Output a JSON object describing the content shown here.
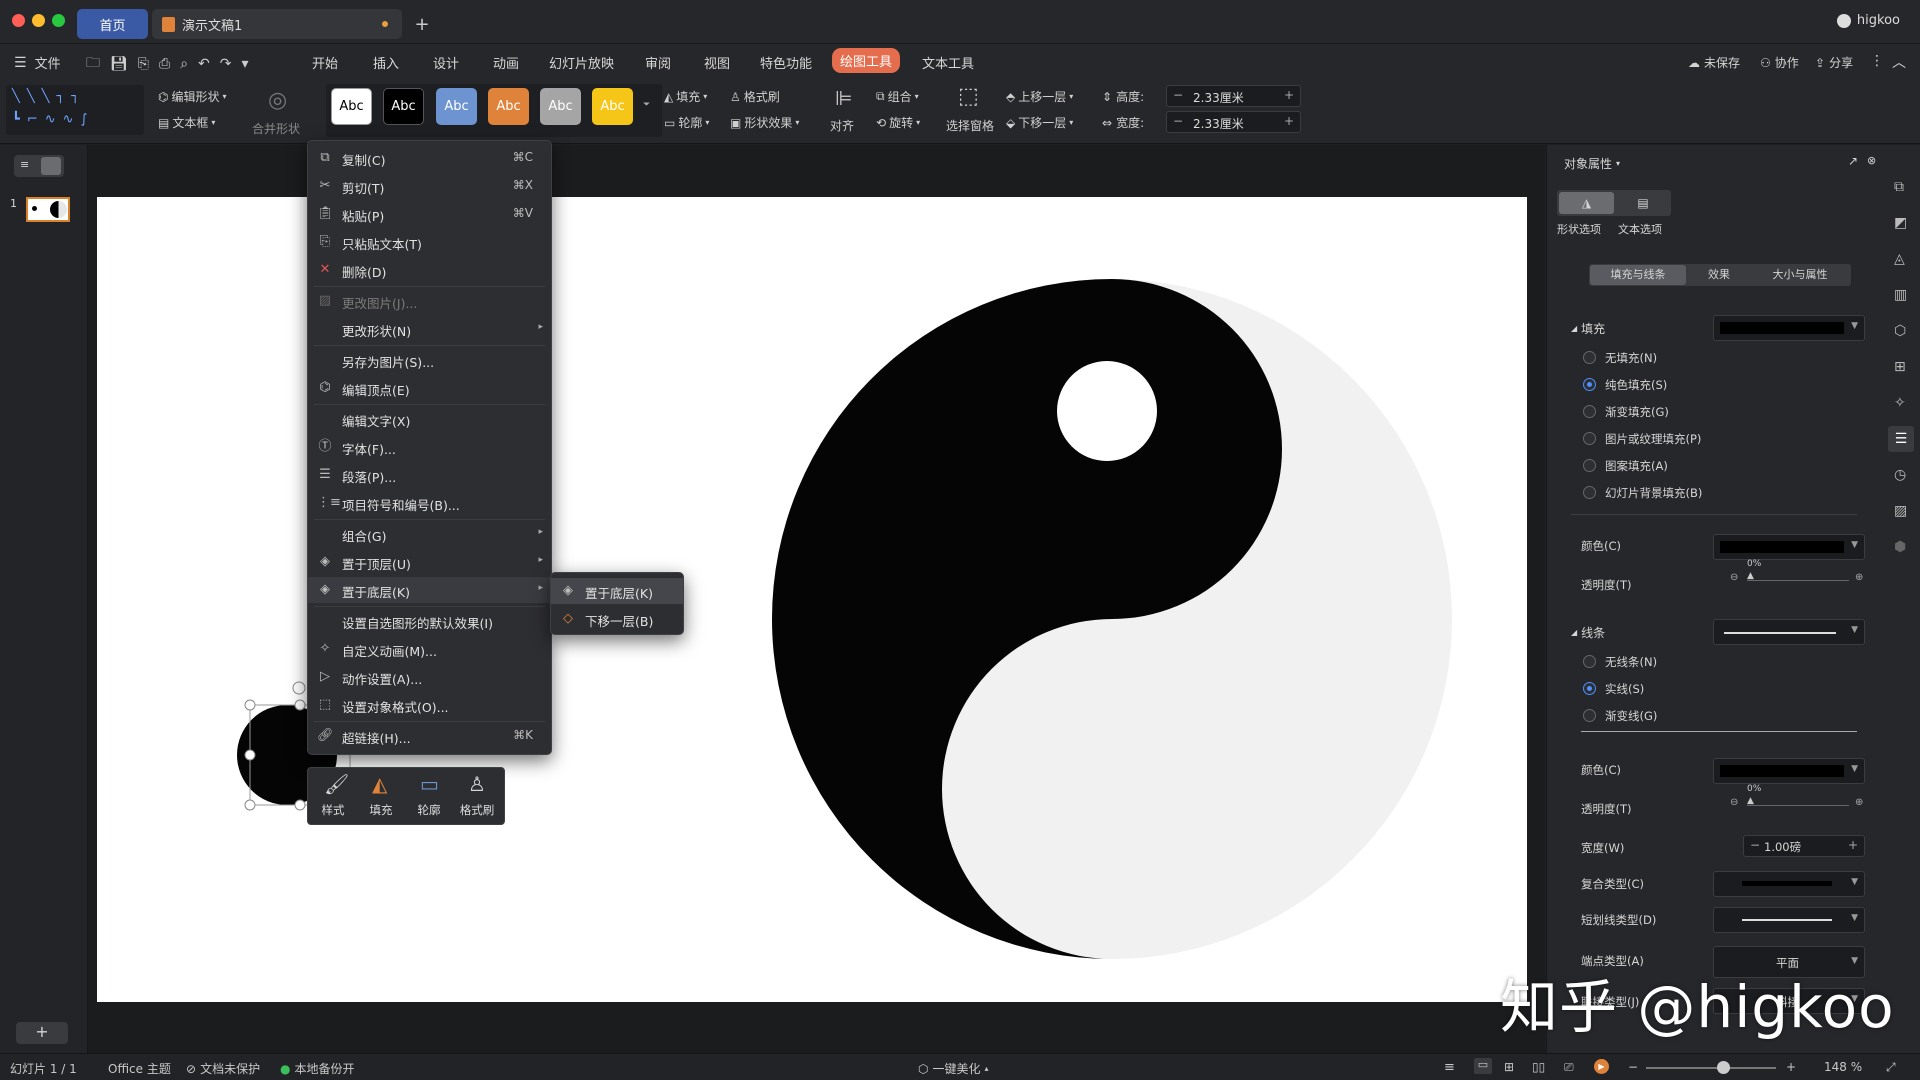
{
  "titlebar": {
    "home_tab": "首页",
    "doc_tab": "演示文稿1",
    "user": "higkoo"
  },
  "menubar": {
    "file": "文件",
    "items": [
      "开始",
      "插入",
      "设计",
      "动画",
      "幻灯片放映",
      "审阅",
      "视图",
      "特色功能",
      "绘图工具",
      "文本工具"
    ],
    "active": "绘图工具",
    "unsaved": "未保存",
    "collab": "协作",
    "share": "分享"
  },
  "ribbon": {
    "edit_shape": "编辑形状",
    "textbox": "文本框",
    "merge_shape": "合并形状",
    "style_label": "Abc",
    "fill": "填充",
    "format_brush": "格式刷",
    "outline": "轮廓",
    "shape_effect": "形状效果",
    "align": "对齐",
    "group": "组合",
    "rotate": "旋转",
    "select_pane": "选择窗格",
    "bring_forward": "上移一层",
    "send_backward": "下移一层",
    "height_label": "高度:",
    "width_label": "宽度:",
    "height_value": "2.33厘米",
    "width_value": "2.33厘米"
  },
  "leftpanel": {
    "slide_num": "1"
  },
  "context_menu": {
    "copy": "复制(C)",
    "copy_sc": "⌘C",
    "cut": "剪切(T)",
    "cut_sc": "⌘X",
    "paste": "粘贴(P)",
    "paste_sc": "⌘V",
    "paste_text": "只粘贴文本(T)",
    "delete": "删除(D)",
    "change_pic": "更改图片(J)...",
    "change_shape": "更改形状(N)",
    "save_as_pic": "另存为图片(S)...",
    "edit_points": "编辑顶点(E)",
    "edit_text": "编辑文字(X)",
    "font": "字体(F)...",
    "paragraph": "段落(P)...",
    "bullets": "项目符号和编号(B)...",
    "group": "组合(G)",
    "bring_top": "置于顶层(U)",
    "send_bottom": "置于底层(K)",
    "set_default": "设置自选图形的默认效果(I)",
    "custom_anim": "自定义动画(M)...",
    "action": "动作设置(A)...",
    "format_obj": "设置对象格式(O)...",
    "hyperlink": "超链接(H)...",
    "hyperlink_sc": "⌘K"
  },
  "submenu": {
    "send_to_back": "置于底层(K)",
    "send_backward": "下移一层(B)"
  },
  "mini_toolbar": {
    "style": "样式",
    "fill": "填充",
    "outline": "轮廓",
    "format_brush": "格式刷"
  },
  "rightpanel": {
    "title": "对象属性",
    "tab_shape": "形状选项",
    "tab_text": "文本选项",
    "subtabs": [
      "填充与线条",
      "效果",
      "大小与属性"
    ],
    "fill_section": "填充",
    "fill_options": [
      "无填充(N)",
      "纯色填充(S)",
      "渐变填充(G)",
      "图片或纹理填充(P)",
      "图案填充(A)",
      "幻灯片背景填充(B)"
    ],
    "color": "颜色(C)",
    "transparency": "透明度(T)",
    "transparency_value": "0%",
    "line_section": "线条",
    "line_options": [
      "无线条(N)",
      "实线(S)",
      "渐变线(G)"
    ],
    "line_color": "颜色(C)",
    "line_transparency": "透明度(T)",
    "line_transparency_value": "0%",
    "width": "宽度(W)",
    "width_value": "1.00磅",
    "compound": "复合类型(C)",
    "dash": "短划线类型(D)",
    "cap": "端点类型(A)",
    "cap_value": "平面",
    "join": "联接类型(J)",
    "join_value": "斜接"
  },
  "statusbar": {
    "slide": "幻灯片 1 / 1",
    "theme": "Office 主题",
    "protect": "文档未保护",
    "backup": "本地备份开",
    "beautify": "一键美化",
    "zoom": "148 %"
  },
  "watermark": "知乎 @higkoo",
  "colors": {
    "accent": "#3a5aa6",
    "active_tab": "#e46d4e",
    "radio": "#4d8fff",
    "style_blue": "#6d93d0",
    "style_orange": "#e0833a",
    "style_gray": "#a5a5a5",
    "style_yellow": "#f5c518"
  }
}
